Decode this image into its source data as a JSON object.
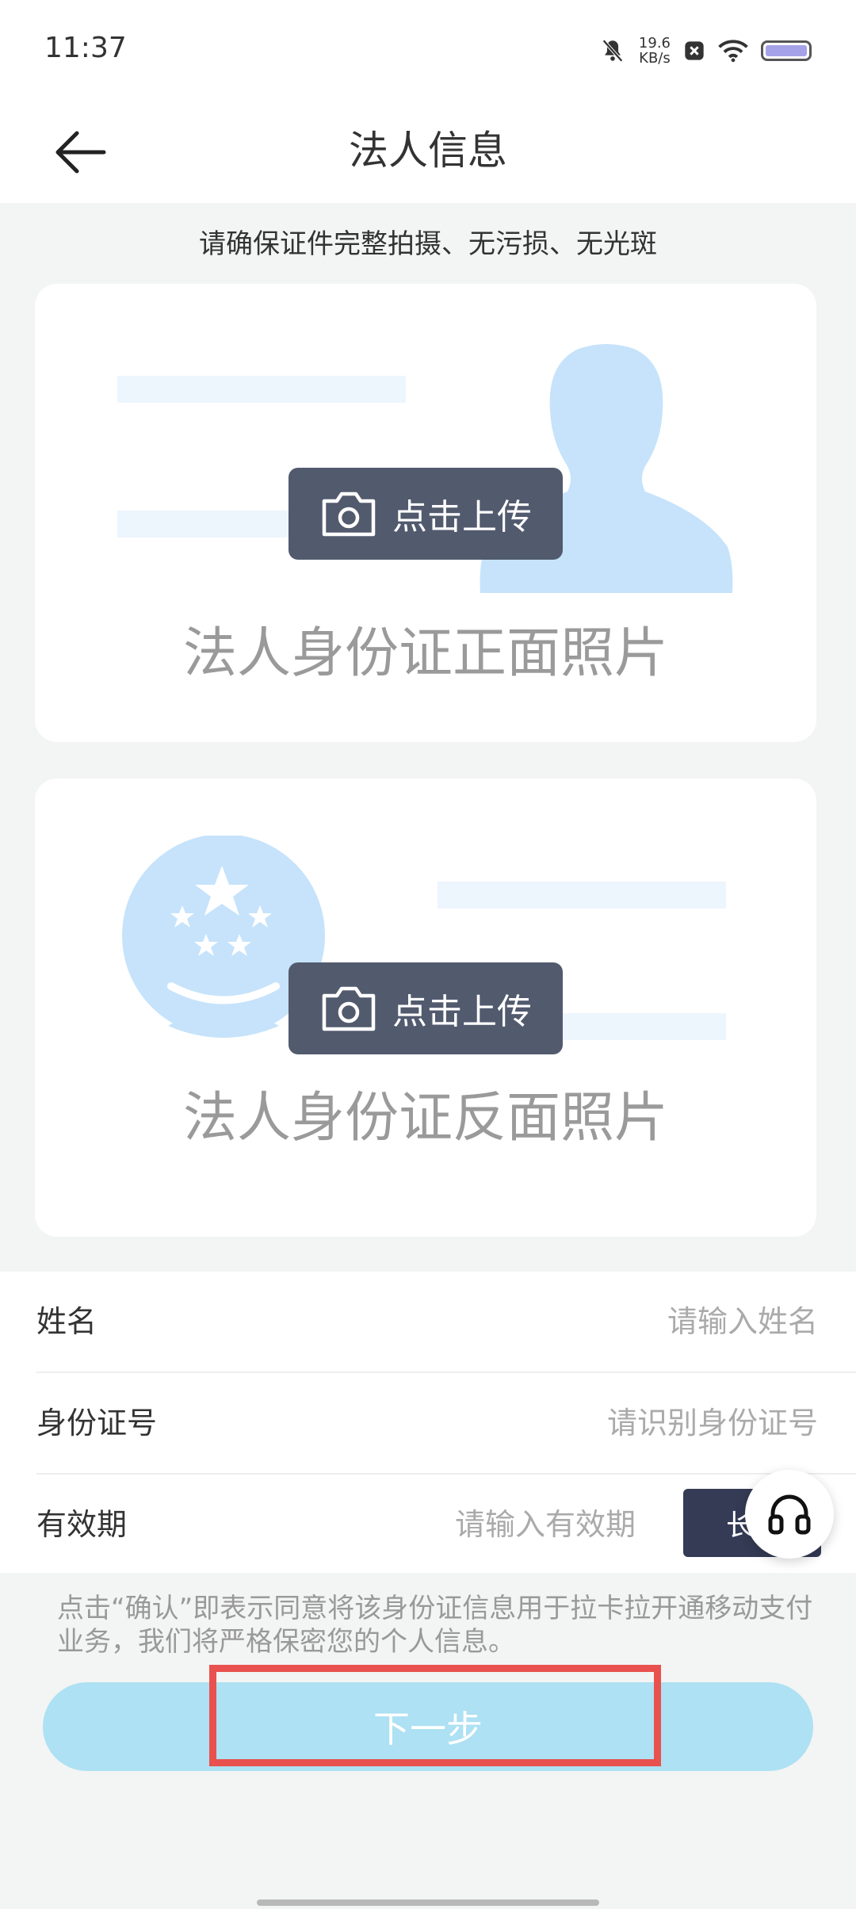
{
  "status_bar": {
    "time": "11:37",
    "net_speed_value": "19.6",
    "net_speed_unit": "KB/s",
    "icons": [
      "mute-bell-icon",
      "close-box-icon",
      "wifi-icon",
      "battery-icon"
    ]
  },
  "nav": {
    "back_icon": "arrow-left-icon",
    "title": "法人信息"
  },
  "hint": "请确保证件完整拍摄、无污损、无光斑",
  "front_card": {
    "upload_label": "点击上传",
    "caption": "法人身份证正面照片"
  },
  "back_card": {
    "upload_label": "点击上传",
    "caption": "法人身份证反面照片"
  },
  "form": {
    "name": {
      "label": "姓名",
      "placeholder": "请输入姓名"
    },
    "id_number": {
      "label": "身份证号",
      "placeholder": "请识别身份证号"
    },
    "validity": {
      "label": "有效期",
      "placeholder": "请输入有效期",
      "long_term_label": "长"
    }
  },
  "agreement_text": "点击“确认”即表示同意将该身份证信息用于拉卡拉开通移动支付业务，我们将严格保密您的个人信息。",
  "next_button": "下一步",
  "colors": {
    "next_button_bg": "#ade1f3",
    "upload_button_bg": "#525a6e",
    "highlight": "#e9514e",
    "long_term_bg": "#353b55"
  }
}
